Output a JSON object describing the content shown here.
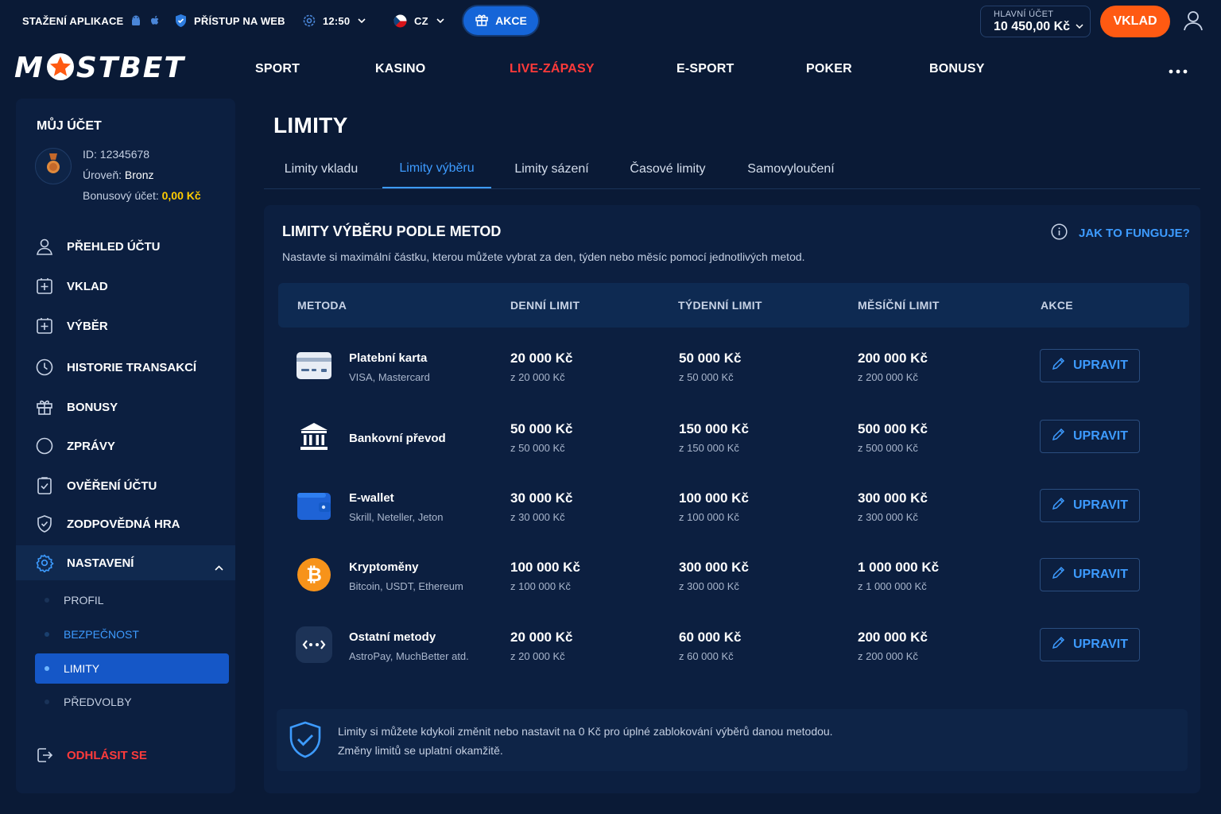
{
  "topbar": {
    "download_app": "STAŽENÍ APLIKACE",
    "web_access": "PŘÍSTUP NA WEB",
    "time": "12:50",
    "language": "CZ",
    "akce": "AKCE",
    "main_account_label": "HLAVNÍ ÚČET",
    "main_account_value": "10 450,00 Kč",
    "deposit_button": "VKLAD"
  },
  "brand": {
    "logo_left": "M",
    "logo_right": "STBET",
    "accent": "#ff5a12",
    "primary_blue": "#1565d8"
  },
  "nav": {
    "items": [
      "SPORT",
      "KASINO",
      "LIVE-ZÁPASY",
      "E-SPORT",
      "POKER",
      "BONUSY"
    ]
  },
  "sidebar": {
    "title": "MŮJ ÚČET",
    "id_line": "ID: 12345678",
    "level_label": "Úroveň: ",
    "level_value": "Bronz",
    "bonus_label": "Bonusový účet: ",
    "bonus_value": "0,00 Kč",
    "menu": [
      {
        "label": "PŘEHLED ÚČTU",
        "icon": "user-icon"
      },
      {
        "label": "VKLAD",
        "icon": "deposit-icon"
      },
      {
        "label": "VÝBĚR",
        "icon": "withdraw-icon"
      },
      {
        "label": "HISTORIE TRANSAKCÍ",
        "icon": "history-icon"
      },
      {
        "label": "BONUSY",
        "icon": "gift-icon"
      },
      {
        "label": "ZPRÁVY",
        "icon": "message-icon"
      },
      {
        "label": "OVĚŘENÍ ÚČTU",
        "icon": "verify-icon"
      },
      {
        "label": "ZODPOVĚDNÁ HRA",
        "icon": "shield-icon"
      },
      {
        "label": "NASTAVENÍ",
        "icon": "gear-icon"
      }
    ],
    "submenu": [
      "PROFIL",
      "BEZPEČNOST",
      "LIMITY",
      "PŘEDVOLBY"
    ],
    "logout": "ODHLÁSIT SE"
  },
  "main": {
    "title": "LIMITY",
    "tabs": [
      "Limity vkladu",
      "Limity výběru",
      "Limity sázení",
      "Časové limity",
      "Samovyloučení"
    ],
    "active_tab": "Limity výběru",
    "section_title": "LIMITY VÝBĚRU PODLE METOD",
    "section_desc": "Nastavte si maximální částku, kterou můžete vybrat za den, týden nebo měsíc pomocí jednotlivých metod.",
    "how_link": "JAK TO FUNGUJE?",
    "table": {
      "headers": [
        "METODA",
        "DENNÍ LIMIT",
        "TÝDENNÍ LIMIT",
        "MĚSÍČNÍ LIMIT",
        "AKCE"
      ],
      "edit_label": "UPRAVIT",
      "rows": [
        {
          "name": "Platební karta",
          "sub": "VISA, Mastercard",
          "icon": "credit-card-icon",
          "daily": "20 000 Kč",
          "daily_sub": "z 20 000 Kč",
          "weekly": "50 000 Kč",
          "weekly_sub": "z 50 000 Kč",
          "monthly": "200 000 Kč",
          "monthly_sub": "z 200 000 Kč"
        },
        {
          "name": "Bankovní převod",
          "sub": "",
          "icon": "bank-icon",
          "daily": "50 000 Kč",
          "daily_sub": "z 50 000 Kč",
          "weekly": "150 000 Kč",
          "weekly_sub": "z 150 000 Kč",
          "monthly": "500 000 Kč",
          "monthly_sub": "z 500 000 Kč"
        },
        {
          "name": "E-wallet",
          "sub": "Skrill, Neteller, Jeton",
          "icon": "wallet-icon",
          "daily": "30 000 Kč",
          "daily_sub": "z 30 000 Kč",
          "weekly": "100 000 Kč",
          "weekly_sub": "z 100 000 Kč",
          "monthly": "300 000 Kč",
          "monthly_sub": "z 300 000 Kč"
        },
        {
          "name": "Kryptoměny",
          "sub": "Bitcoin, USDT, Ethereum",
          "icon": "bitcoin-icon",
          "daily": "100 000 Kč",
          "daily_sub": "z 100 000 Kč",
          "weekly": "300 000 Kč",
          "weekly_sub": "z 300 000 Kč",
          "monthly": "1 000 000 Kč",
          "monthly_sub": "z 1 000 000 Kč"
        },
        {
          "name": "Ostatní metody",
          "sub": "AstroPay, MuchBetter atd.",
          "icon": "other-methods-icon",
          "daily": "20 000 Kč",
          "daily_sub": "z 20 000 Kč",
          "weekly": "60 000 Kč",
          "weekly_sub": "z 60 000 Kč",
          "monthly": "200 000 Kč",
          "monthly_sub": "z 200 000 Kč"
        }
      ]
    },
    "notice_line1": "Limity si můžete kdykoli změnit nebo nastavit na 0 Kč pro úplné zablokování výběrů danou metodou.",
    "notice_line2": "Změny limitů se uplatní okamžitě."
  }
}
